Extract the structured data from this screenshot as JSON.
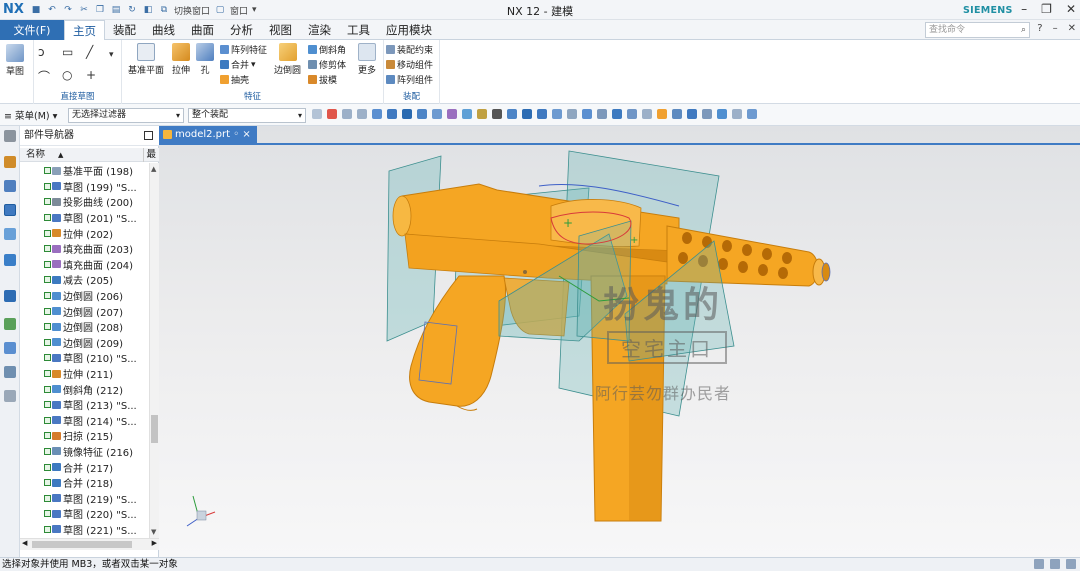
{
  "app": {
    "logo": "NX",
    "window_title": "NX 12 - 建模",
    "brand": "SIEMENS",
    "search_placeholder": "查找命令",
    "quick_access": {
      "switch_window": "切换窗口",
      "window_menu": "窗口"
    }
  },
  "menubar": {
    "file": "文件(F)",
    "tabs": [
      "主页",
      "装配",
      "曲线",
      "曲面",
      "分析",
      "视图",
      "渲染",
      "工具",
      "应用模块"
    ]
  },
  "ribbon": {
    "groups": {
      "sketch": "草图",
      "direct_sketch": "直接草图",
      "feature": "特征",
      "assembly": "装配"
    },
    "buttons": {
      "datum_plane": "基准平面",
      "extrude": "拉伸",
      "hole": "孔",
      "pattern_feature": "阵列特征",
      "unite": "合并",
      "shell": "抽壳",
      "edge_blend": "边倒圆",
      "chamfer": "倒斜角",
      "trim_body": "修剪体",
      "draft": "拔模",
      "more": "更多",
      "assembly_constraint": "装配约束",
      "move_component": "移动组件",
      "pattern_component": "阵列组件"
    }
  },
  "toolbar": {
    "menu": "菜单(M)",
    "filter": "无选择过滤器",
    "scope": "整个装配"
  },
  "navigator": {
    "title": "部件导航器",
    "col_name": "名称",
    "col_latest": "最",
    "items": [
      {
        "label": "基准平面 (198)",
        "icon": "datum-plane",
        "color": "#8aa0b8"
      },
      {
        "label": "草图 (199) \"S...",
        "icon": "sketch",
        "color": "#4a78c2"
      },
      {
        "label": "投影曲线 (200)",
        "icon": "projected-curve",
        "color": "#7d8b99"
      },
      {
        "label": "草图 (201) \"S...",
        "icon": "sketch",
        "color": "#4a78c2"
      },
      {
        "label": "拉伸 (202)",
        "icon": "extrude",
        "color": "#d88a2a"
      },
      {
        "label": "填充曲面 (203)",
        "icon": "fill-surface",
        "color": "#9a6fbf"
      },
      {
        "label": "填充曲面 (204)",
        "icon": "fill-surface",
        "color": "#9a6fbf"
      },
      {
        "label": "减去 (205)",
        "icon": "subtract",
        "color": "#3d7ac0"
      },
      {
        "label": "边倒圆 (206)",
        "icon": "edge-blend",
        "color": "#4f8fd0"
      },
      {
        "label": "边倒圆 (207)",
        "icon": "edge-blend",
        "color": "#4f8fd0"
      },
      {
        "label": "边倒圆 (208)",
        "icon": "edge-blend",
        "color": "#4f8fd0"
      },
      {
        "label": "边倒圆 (209)",
        "icon": "edge-blend",
        "color": "#4f8fd0"
      },
      {
        "label": "草图 (210) \"S...",
        "icon": "sketch",
        "color": "#4a78c2"
      },
      {
        "label": "拉伸 (211)",
        "icon": "extrude",
        "color": "#d88a2a"
      },
      {
        "label": "倒斜角 (212)",
        "icon": "chamfer",
        "color": "#4f8fd0"
      },
      {
        "label": "草图 (213) \"S...",
        "icon": "sketch",
        "color": "#4a78c2"
      },
      {
        "label": "草图 (214) \"S...",
        "icon": "sketch",
        "color": "#4a78c2"
      },
      {
        "label": "扫掠 (215)",
        "icon": "swept",
        "color": "#d67b2b"
      },
      {
        "label": "镜像特征 (216)",
        "icon": "mirror-feature",
        "color": "#6a8fb5"
      },
      {
        "label": "合并 (217)",
        "icon": "unite",
        "color": "#3d7ac0"
      },
      {
        "label": "合并 (218)",
        "icon": "unite",
        "color": "#3d7ac0"
      },
      {
        "label": "草图 (219) \"S...",
        "icon": "sketch",
        "color": "#4a78c2"
      },
      {
        "label": "草图 (220) \"S...",
        "icon": "sketch",
        "color": "#4a78c2"
      },
      {
        "label": "草图 (221) \"S...",
        "icon": "sketch",
        "color": "#4a78c2"
      }
    ]
  },
  "viewport": {
    "doc_tab": "model2.prt",
    "model_color": "#f5a623",
    "plane_color": "#5fb3b3"
  },
  "watermark": {
    "line1": "扮鬼的",
    "line2": "空宅主口",
    "line3": "阿行芸勿群办民者"
  },
  "statusbar": {
    "message": "选择对象并使用 MB3，或者双击某一对象"
  }
}
